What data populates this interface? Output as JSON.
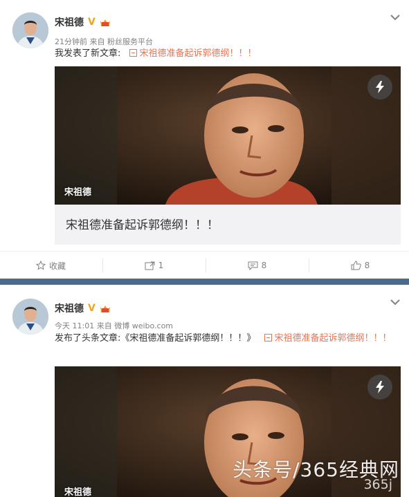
{
  "post1": {
    "author": "宋祖德",
    "v_badge": "V",
    "time": "21分钟前",
    "source": "来自 粉丝服务平台",
    "text": "我发表了新文章:",
    "link_text": "宋祖德准备起诉郭德纲！！！",
    "image_label": "宋祖德",
    "card_title": "宋祖德准备起诉郭德纲！！！",
    "actions": {
      "favorite_label": "收藏",
      "repost_count": "1",
      "comment_count": "8",
      "like_count": "8"
    }
  },
  "post2": {
    "author": "宋祖德",
    "v_badge": "V",
    "time": "今天 11:01",
    "source": "来自 微博 weibo.com",
    "text": "发布了头条文章:《宋祖德准备起诉郭德纲！！！》",
    "link_text": "宋祖德准备起诉郭德纲！！！",
    "image_label": "宋祖德"
  },
  "watermark": {
    "main": "头条号/365经典网",
    "sub": "365j"
  },
  "colors": {
    "link": "#eb7350",
    "divider": "#4c6a8e",
    "v_badge": "#f2a51b"
  }
}
